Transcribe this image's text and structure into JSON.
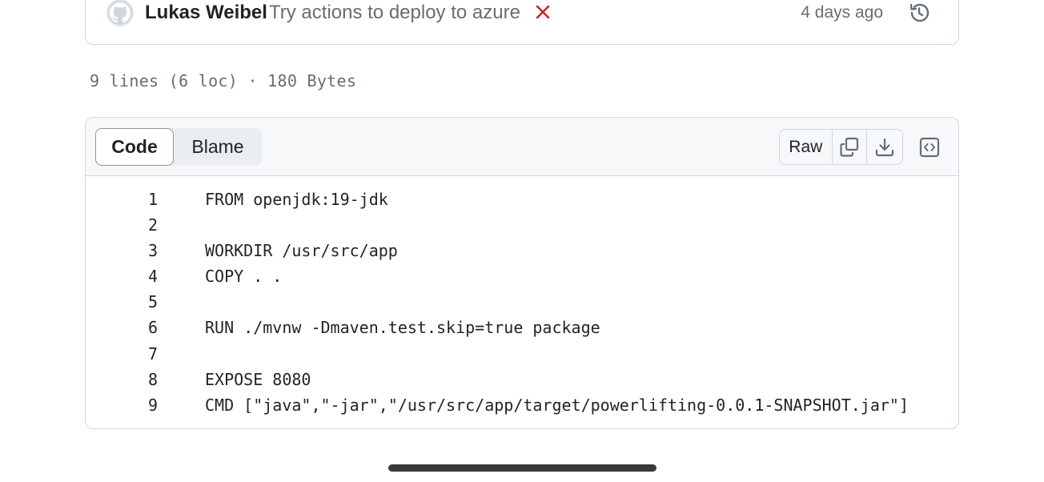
{
  "commit": {
    "author": "Lukas Weibel",
    "message": "Try actions to deploy to azure",
    "time": "4 days ago",
    "status_icon": "x-fail-icon",
    "status_color": "#cf222e"
  },
  "file_info": "9 lines (6 loc) · 180 Bytes",
  "tabs": {
    "code_label": "Code",
    "blame_label": "Blame"
  },
  "toolbar": {
    "raw_label": "Raw",
    "copy_icon": "copy-icon",
    "download_icon": "download-icon",
    "embed_icon": "code-embed-icon"
  },
  "code": {
    "lines": [
      {
        "num": "1",
        "text": "FROM openjdk:19-jdk"
      },
      {
        "num": "2",
        "text": ""
      },
      {
        "num": "3",
        "text": "WORKDIR /usr/src/app"
      },
      {
        "num": "4",
        "text": "COPY . ."
      },
      {
        "num": "5",
        "text": ""
      },
      {
        "num": "6",
        "text": "RUN ./mvnw -Dmaven.test.skip=true package"
      },
      {
        "num": "7",
        "text": ""
      },
      {
        "num": "8",
        "text": "EXPOSE 8080"
      },
      {
        "num": "9",
        "text": "CMD [\"java\",\"-jar\",\"/usr/src/app/target/powerlifting-0.0.1-SNAPSHOT.jar\"]"
      }
    ]
  }
}
